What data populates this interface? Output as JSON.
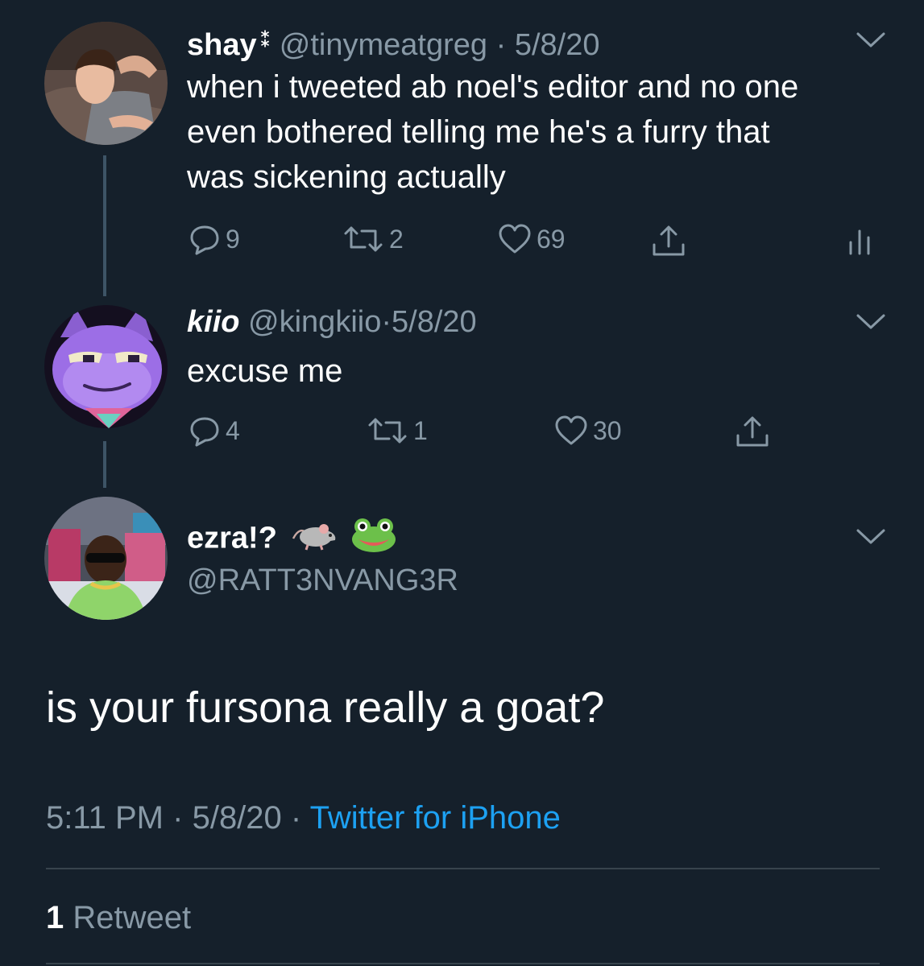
{
  "tweets": [
    {
      "display_name": "shay",
      "badge": "⁑",
      "handle": "@tinymeatgreg",
      "sep": "·",
      "date": "5/8/20",
      "lines": [
        "when i tweeted ab noel's editor and no one",
        "even bothered telling me he's a furry that",
        "was sickening actually"
      ],
      "replies": "9",
      "retweets": "2",
      "likes": "69"
    },
    {
      "display_name": "kiio",
      "handle": "@kingkiio",
      "sep": "·",
      "date": "5/8/20",
      "lines": [
        "excuse me"
      ],
      "replies": "4",
      "retweets": "1",
      "likes": "30"
    }
  ],
  "main_tweet": {
    "display_name": "ezra!?",
    "name_emojis": [
      "rat-emoji",
      "frog-emoji"
    ],
    "handle": "@RATT3NVANG3R",
    "text": "is your fursona really a goat?",
    "time": "5:11 PM",
    "sep1": "·",
    "date": "5/8/20",
    "sep2": "·",
    "source": "Twitter for iPhone",
    "retweet_count": "1",
    "retweet_label": "Retweet"
  },
  "colors": {
    "background": "#15202b",
    "secondary_text": "#8899a6",
    "link": "#1da1f2",
    "divider": "#38444d"
  }
}
